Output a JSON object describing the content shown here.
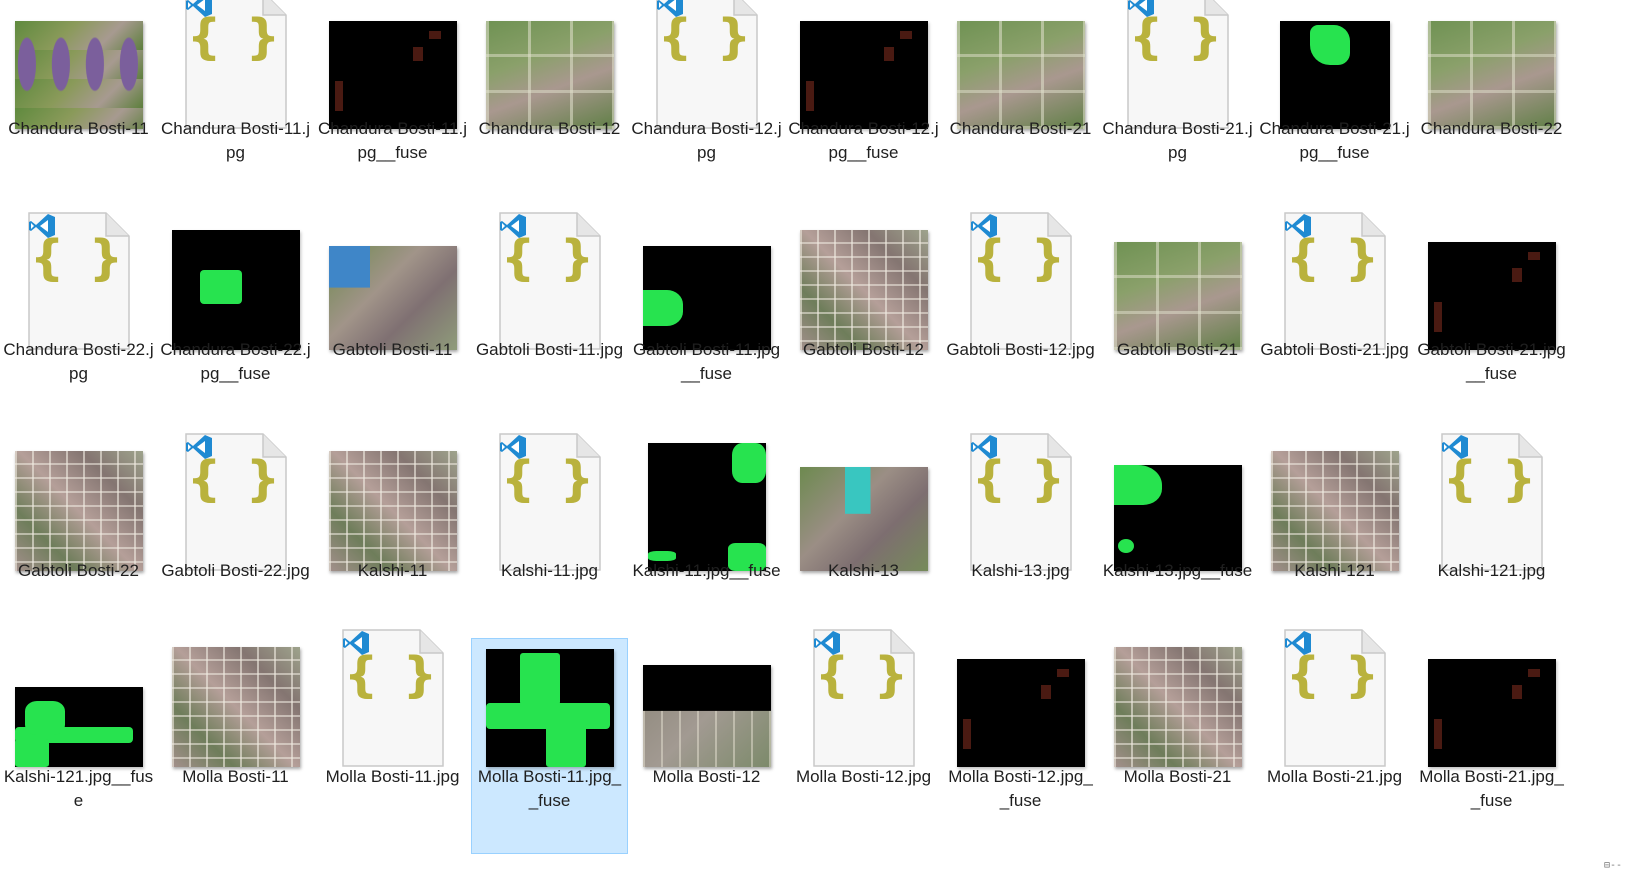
{
  "app": "File Explorer",
  "view": "Large icons",
  "selection_color": "#cce8ff",
  "status_glyph": "⊟--",
  "files": [
    {
      "name": "Chandura Bosti-11",
      "type": "image",
      "thumb": "water"
    },
    {
      "name": "Chandura Bosti-11.jpg",
      "type": "json",
      "icon": "json-file-icon"
    },
    {
      "name": "Chandura Bosti-11.jpg__fuse",
      "type": "mask",
      "thumb": "dark-marks"
    },
    {
      "name": "Chandura Bosti-12",
      "type": "image",
      "thumb": "green"
    },
    {
      "name": "Chandura Bosti-12.jpg",
      "type": "json",
      "icon": "json-file-icon"
    },
    {
      "name": "Chandura Bosti-12.jpg__fuse",
      "type": "mask",
      "thumb": "dark-marks"
    },
    {
      "name": "Chandura Bosti-21",
      "type": "image",
      "thumb": "green"
    },
    {
      "name": "Chandura Bosti-21.jpg",
      "type": "json",
      "icon": "json-file-icon"
    },
    {
      "name": "Chandura Bosti-21.jpg__fuse",
      "type": "mask",
      "thumb": "green-top"
    },
    {
      "name": "Chandura Bosti-22",
      "type": "image",
      "thumb": "green"
    },
    {
      "name": "Chandura Bosti-22.jpg",
      "type": "json",
      "icon": "json-file-icon"
    },
    {
      "name": "Chandura Bosti-22.jpg__fuse",
      "type": "mask",
      "thumb": "green-square"
    },
    {
      "name": "Gabtoli Bosti-11",
      "type": "image",
      "thumb": "blueroof"
    },
    {
      "name": "Gabtoli Bosti-11.jpg",
      "type": "json",
      "icon": "json-file-icon"
    },
    {
      "name": "Gabtoli Bosti-11.jpg__fuse",
      "type": "mask",
      "thumb": "green-left"
    },
    {
      "name": "Gabtoli Bosti-12",
      "type": "image",
      "thumb": "urban"
    },
    {
      "name": "Gabtoli Bosti-12.jpg",
      "type": "json",
      "icon": "json-file-icon"
    },
    {
      "name": "Gabtoli Bosti-21",
      "type": "image",
      "thumb": "green"
    },
    {
      "name": "Gabtoli Bosti-21.jpg",
      "type": "json",
      "icon": "json-file-icon"
    },
    {
      "name": "Gabtoli Bosti-21.jpg__fuse",
      "type": "mask",
      "thumb": "dark-marks"
    },
    {
      "name": "Gabtoli Bosti-22",
      "type": "image",
      "thumb": "urban"
    },
    {
      "name": "Gabtoli Bosti-22.jpg",
      "type": "json",
      "icon": "json-file-icon"
    },
    {
      "name": "Kalshi-11",
      "type": "image",
      "thumb": "urban"
    },
    {
      "name": "Kalshi-11.jpg",
      "type": "json",
      "icon": "json-file-icon"
    },
    {
      "name": "Kalshi-11.jpg__fuse",
      "type": "mask",
      "thumb": "green-edges"
    },
    {
      "name": "Kalshi-13",
      "type": "image",
      "thumb": "teal"
    },
    {
      "name": "Kalshi-13.jpg",
      "type": "json",
      "icon": "json-file-icon"
    },
    {
      "name": "Kalshi-13.jpg__fuse",
      "type": "mask",
      "thumb": "green-corner"
    },
    {
      "name": "Kalshi-121",
      "type": "image",
      "thumb": "urban"
    },
    {
      "name": "Kalshi-121.jpg",
      "type": "json",
      "icon": "json-file-icon"
    },
    {
      "name": "Kalshi-121.jpg__fuse",
      "type": "mask",
      "thumb": "green-band"
    },
    {
      "name": "Molla Bosti-11",
      "type": "image",
      "thumb": "urban"
    },
    {
      "name": "Molla Bosti-11.jpg",
      "type": "json",
      "icon": "json-file-icon"
    },
    {
      "name": "Molla Bosti-11.jpg__fuse",
      "type": "mask",
      "thumb": "green-large",
      "selected": true
    },
    {
      "name": "Molla Bosti-12",
      "type": "image",
      "thumb": "halfblack"
    },
    {
      "name": "Molla Bosti-12.jpg",
      "type": "json",
      "icon": "json-file-icon"
    },
    {
      "name": "Molla Bosti-12.jpg__fuse",
      "type": "mask",
      "thumb": "dark-marks"
    },
    {
      "name": "Molla Bosti-21",
      "type": "image",
      "thumb": "urban"
    },
    {
      "name": "Molla Bosti-21.jpg",
      "type": "json",
      "icon": "json-file-icon"
    },
    {
      "name": "Molla Bosti-21.jpg__fuse",
      "type": "mask",
      "thumb": "dark-marks"
    }
  ]
}
